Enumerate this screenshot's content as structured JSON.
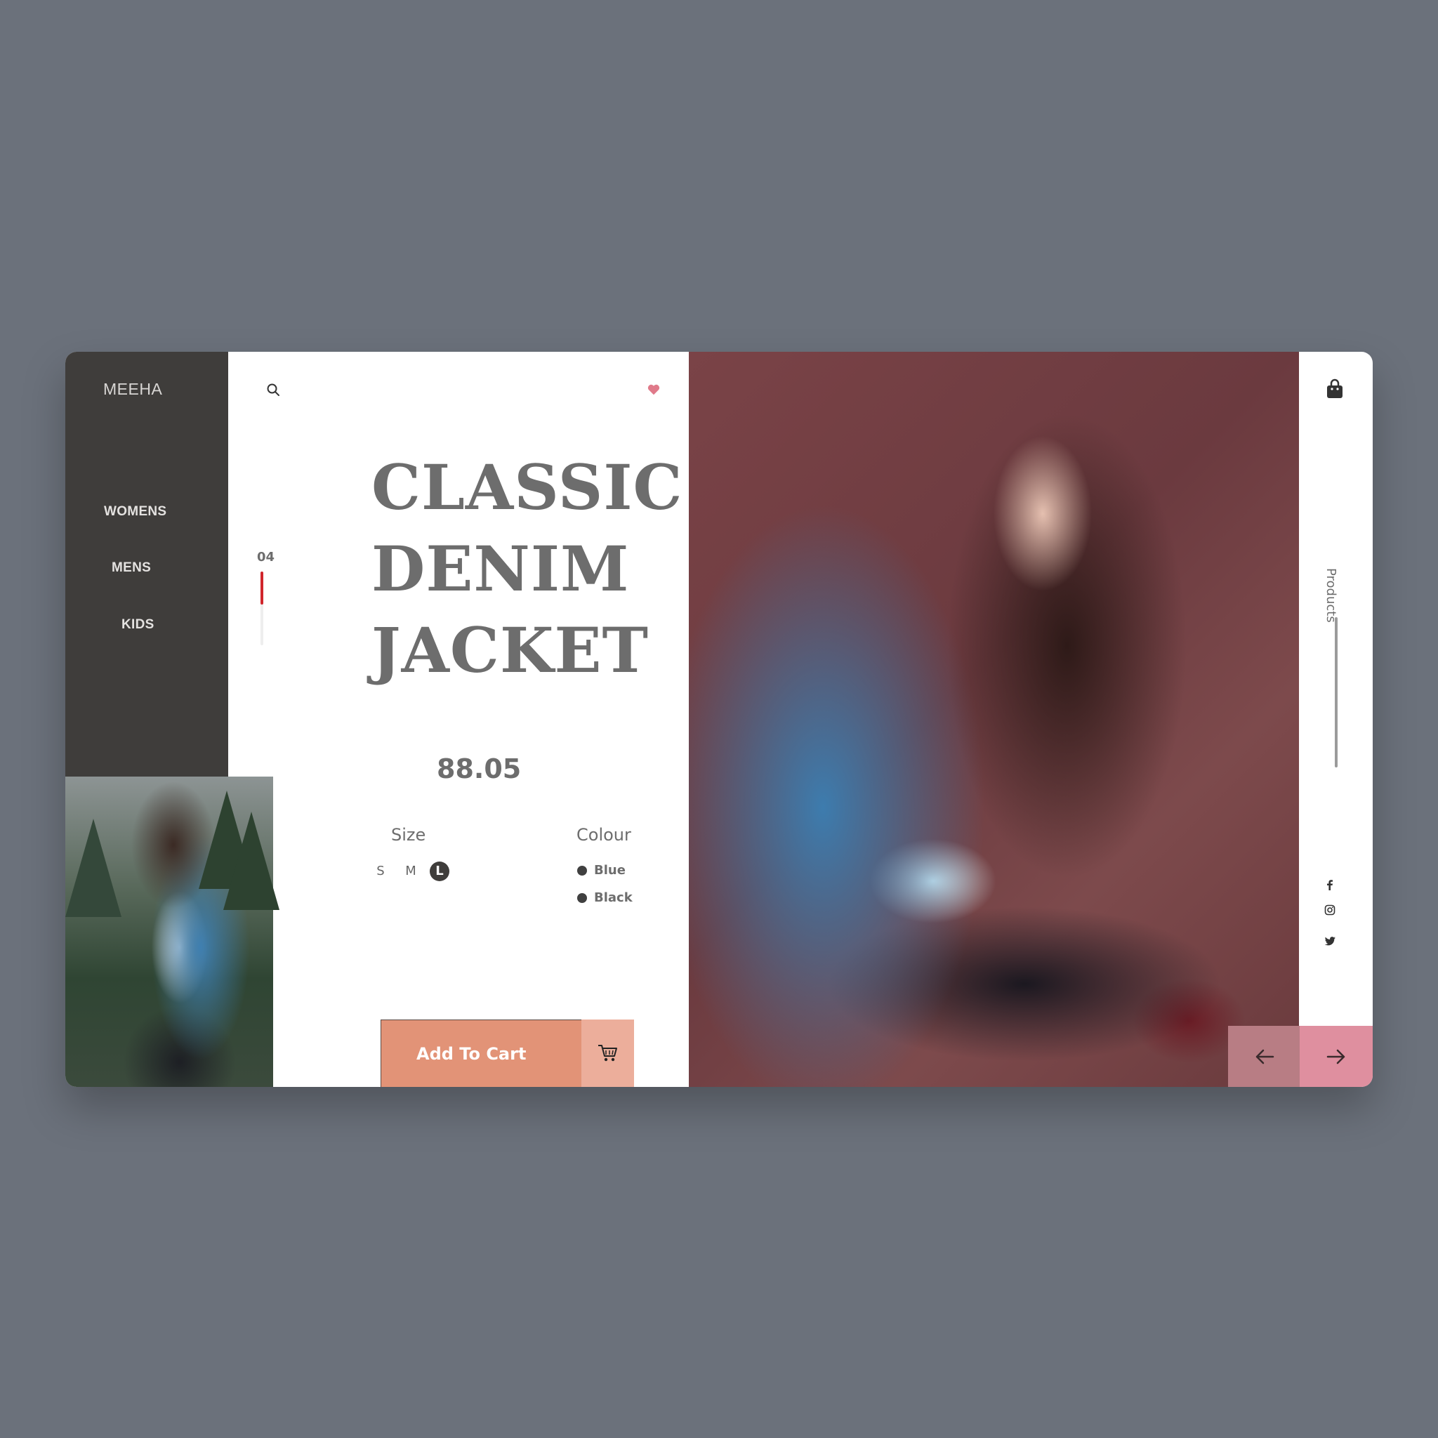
{
  "brand": {
    "name": "MEEHA"
  },
  "nav": {
    "items": [
      {
        "label": "WOMENS"
      },
      {
        "label": "MENS"
      },
      {
        "label": "KIDS"
      }
    ]
  },
  "slider": {
    "current": "04",
    "progress": 0.45
  },
  "product": {
    "title_lines": [
      "CLASSIC",
      "DENIM",
      "JACKET"
    ],
    "price": "88.05",
    "size_label": "Size",
    "sizes": [
      "S",
      "M",
      "L"
    ],
    "selected_size": "L",
    "colour_label": "Colour",
    "colours": [
      {
        "name": "Blue",
        "swatch": "#404040"
      },
      {
        "name": "Black",
        "swatch": "#404040"
      }
    ],
    "add_to_cart_label": "Add To Cart"
  },
  "rail": {
    "section_label": "Products"
  },
  "icons": {
    "search": "search-icon",
    "favorite": "heart-icon",
    "bag": "shopping-bag-icon",
    "cart": "cart-icon",
    "social": [
      "facebook-icon",
      "instagram-icon",
      "twitter-icon"
    ],
    "prev": "arrow-left-icon",
    "next": "arrow-right-icon"
  },
  "colors": {
    "sidebar": "#3f3d3b",
    "accent_cart": "#e29377",
    "accent_cart_light": "#ecae9b",
    "heart": "#e07a8a",
    "progress": "#d0262c",
    "prev_button": "#b87d84",
    "next_button": "#df8f9f"
  }
}
